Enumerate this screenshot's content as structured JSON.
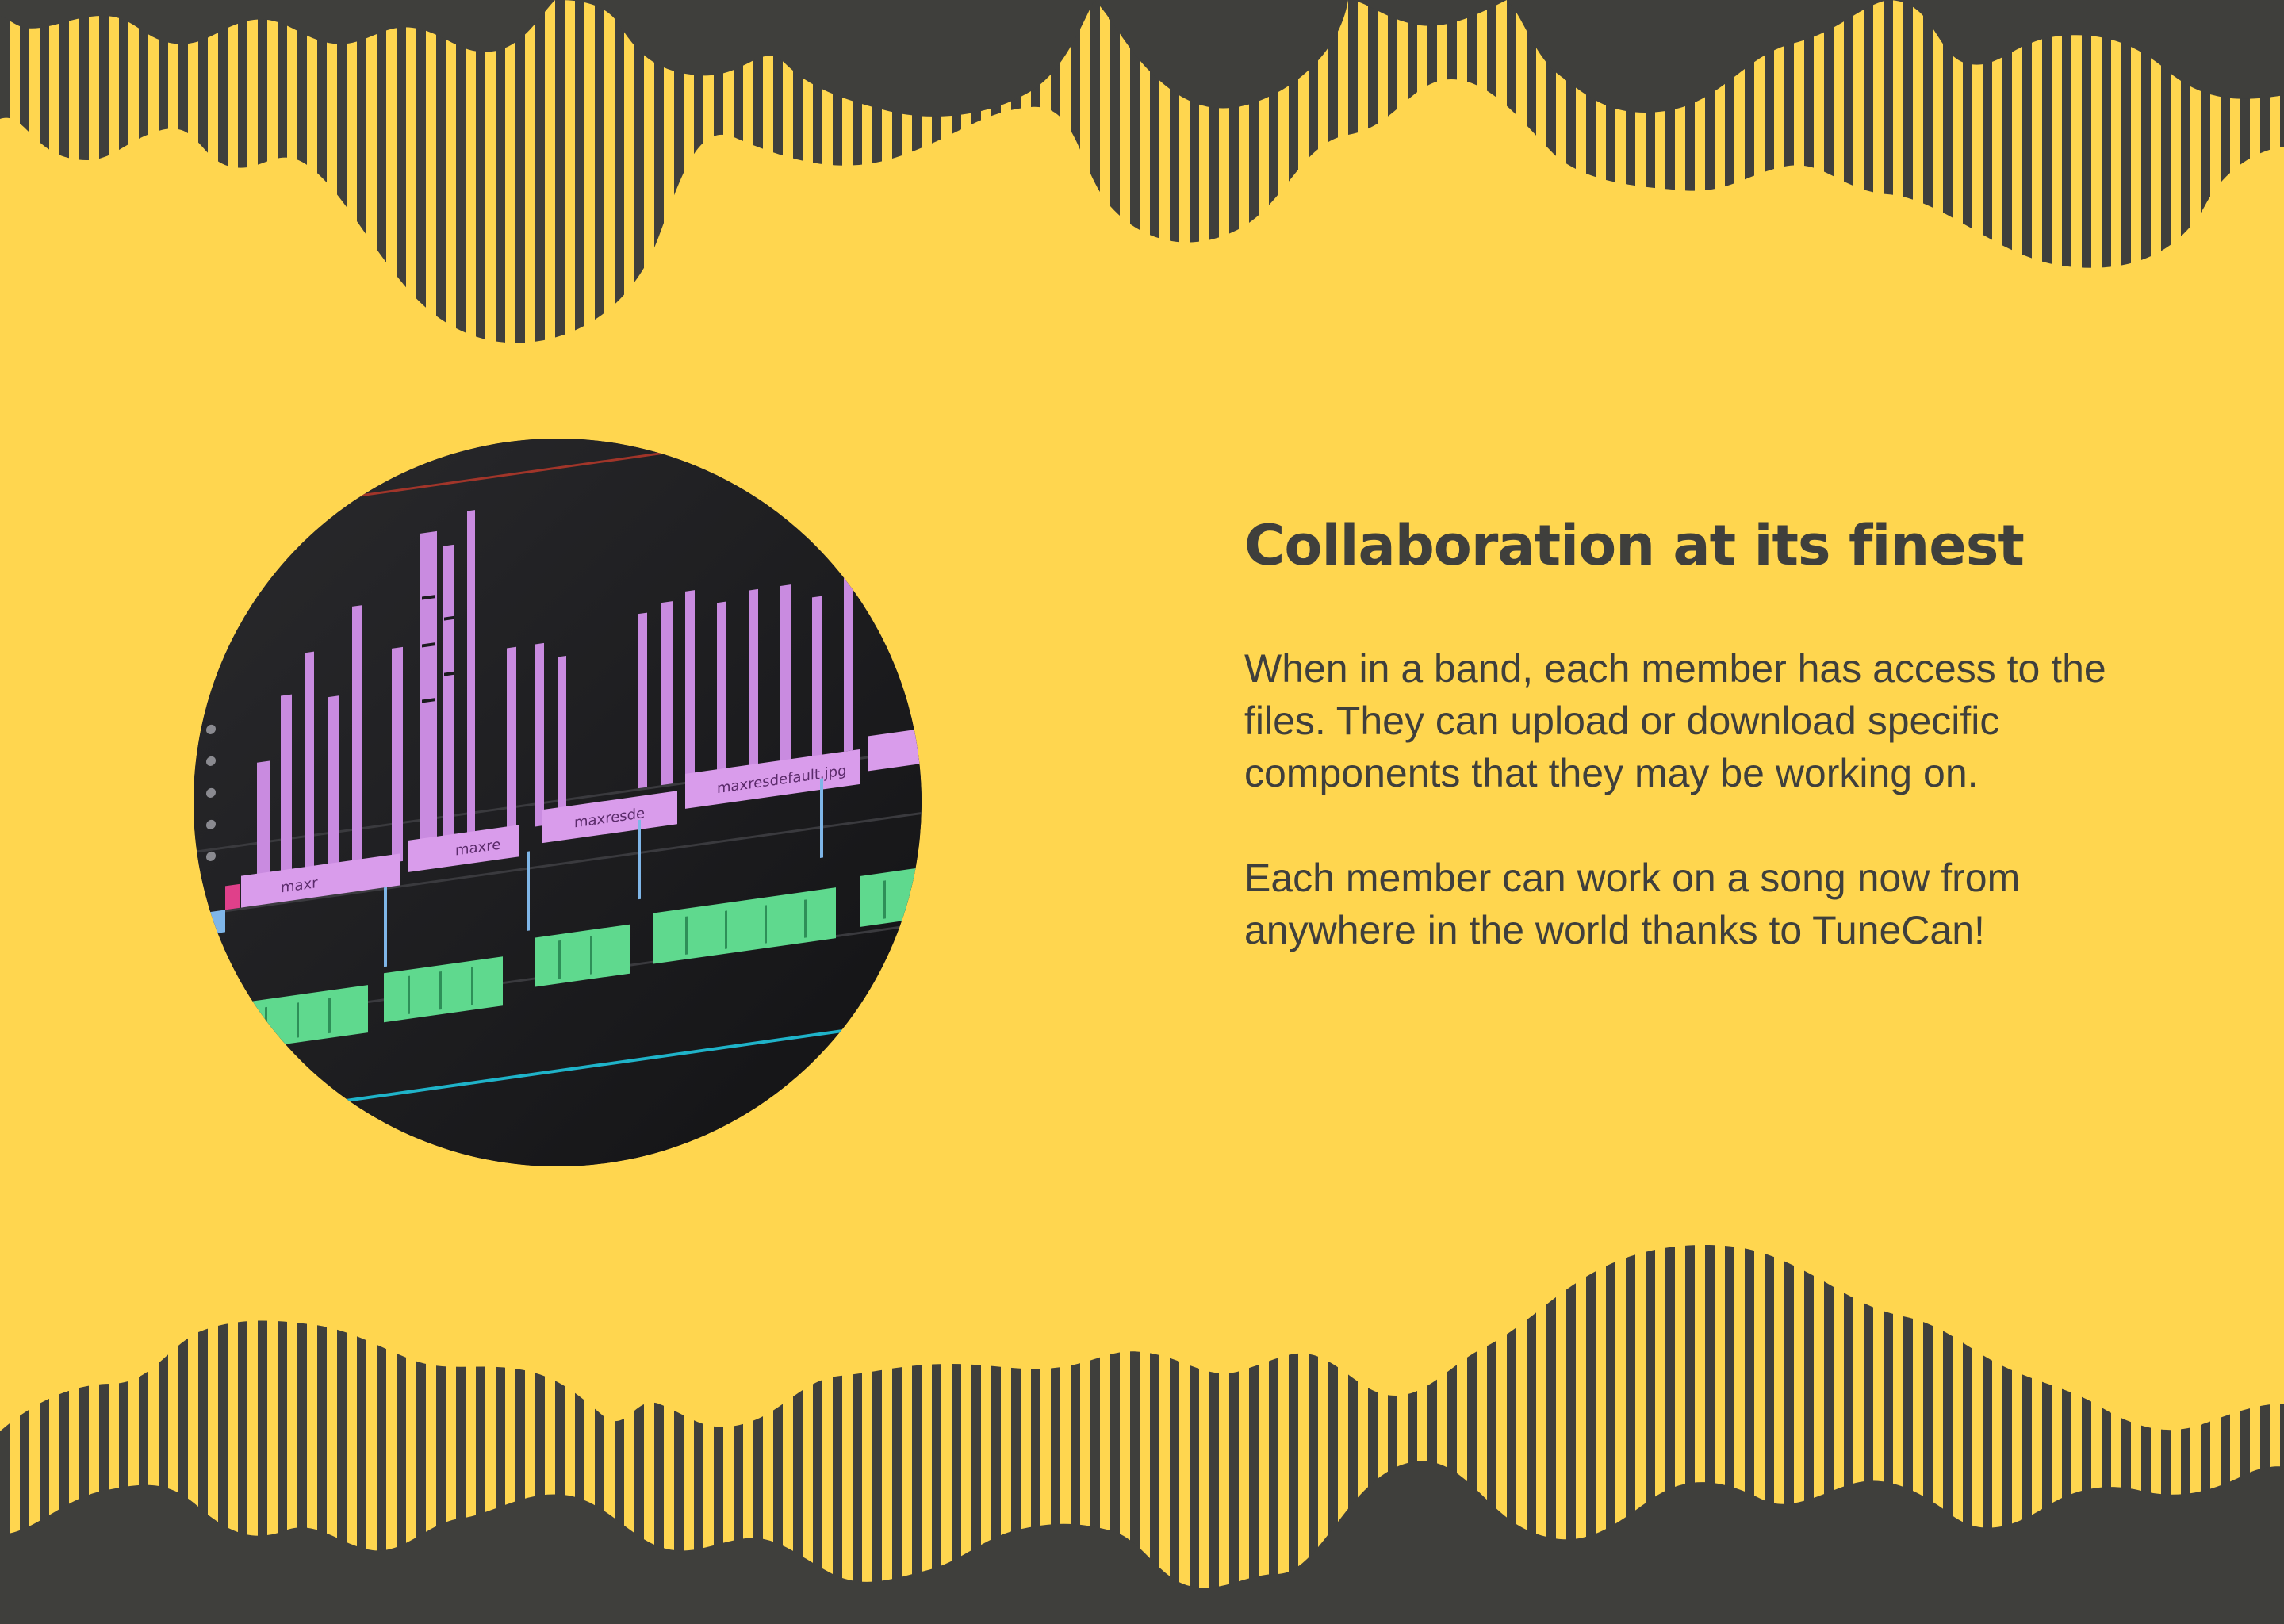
{
  "heading": "Collaboration at its finest",
  "paragraphs": [
    "When in a band, each member has access to the files. They can upload or download specific components that they may be working on.",
    "Each member can work on a song now from anywhere in the world thanks to TuneCan!"
  ],
  "photo": {
    "subject": "audio-editing-timeline",
    "clip_labels": [
      "maxresdefault.jpg",
      "maxresde",
      "maxre",
      "maxr"
    ]
  },
  "colors": {
    "background": "#FFD64F",
    "dark": "#3F3F3C",
    "text": "#3F3F3C",
    "clip_purple": "#C98BE0",
    "clip_green": "#5FD98E"
  }
}
